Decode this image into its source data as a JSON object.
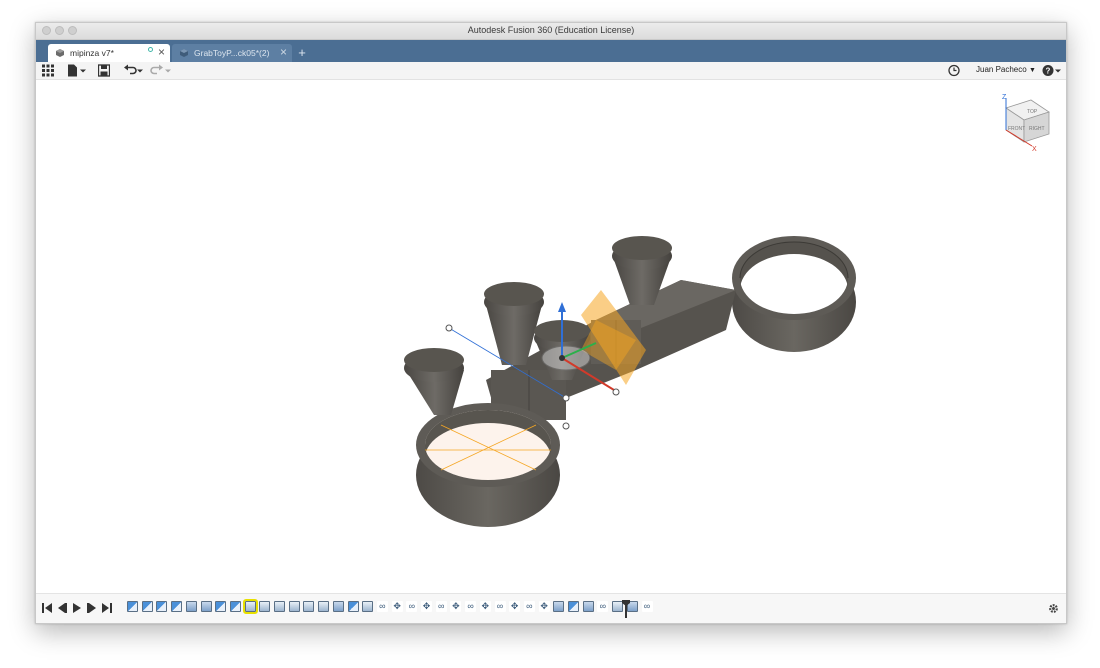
{
  "window": {
    "title": "Autodesk Fusion 360 (Education License)"
  },
  "tabs": [
    {
      "label": "mipinza v7*",
      "active": true,
      "icon": "component-icon"
    },
    {
      "label": "GrabToyP...ck05*(2)",
      "active": false,
      "icon": "component-icon"
    }
  ],
  "toolbar": {
    "user_name": "Juan Pacheco",
    "icons": [
      "grid-icon",
      "file-icon",
      "save-icon",
      "undo-icon",
      "redo-icon",
      "clock-icon",
      "help-icon"
    ]
  },
  "viewcube": {
    "top_label": "TOP",
    "front_label": "FRONT",
    "right_label": "RIGHT",
    "axis_z": "Z",
    "axis_x": "X"
  },
  "timeline": {
    "controls": [
      "first-icon",
      "previous-icon",
      "play-icon",
      "next-icon",
      "last-icon"
    ],
    "features": [
      {
        "type": "sketch"
      },
      {
        "type": "sketch"
      },
      {
        "type": "sketch"
      },
      {
        "type": "sketch"
      },
      {
        "type": "extrude"
      },
      {
        "type": "extrude"
      },
      {
        "type": "sketch"
      },
      {
        "type": "sketch"
      },
      {
        "type": "body"
      },
      {
        "type": "body"
      },
      {
        "type": "body"
      },
      {
        "type": "body"
      },
      {
        "type": "body"
      },
      {
        "type": "body"
      },
      {
        "type": "extrude"
      },
      {
        "type": "sketch"
      },
      {
        "type": "body"
      },
      {
        "type": "joint"
      },
      {
        "type": "move"
      },
      {
        "type": "joint"
      },
      {
        "type": "move"
      },
      {
        "type": "joint"
      },
      {
        "type": "move"
      },
      {
        "type": "joint"
      },
      {
        "type": "move"
      },
      {
        "type": "joint"
      },
      {
        "type": "move"
      },
      {
        "type": "joint"
      },
      {
        "type": "move"
      },
      {
        "type": "extrude"
      },
      {
        "type": "sketch"
      },
      {
        "type": "extrude"
      },
      {
        "type": "joint"
      },
      {
        "type": "body"
      },
      {
        "type": "extrude"
      },
      {
        "type": "joint"
      }
    ],
    "highlighted_index": 8
  },
  "colors": {
    "tab_bar": "#4b6e93",
    "model_body": "#5a5752",
    "plane_orange": "#f5a623",
    "axis_blue": "#2f6fd6",
    "axis_red": "#d23a2a",
    "highlight": "#e8e000"
  }
}
